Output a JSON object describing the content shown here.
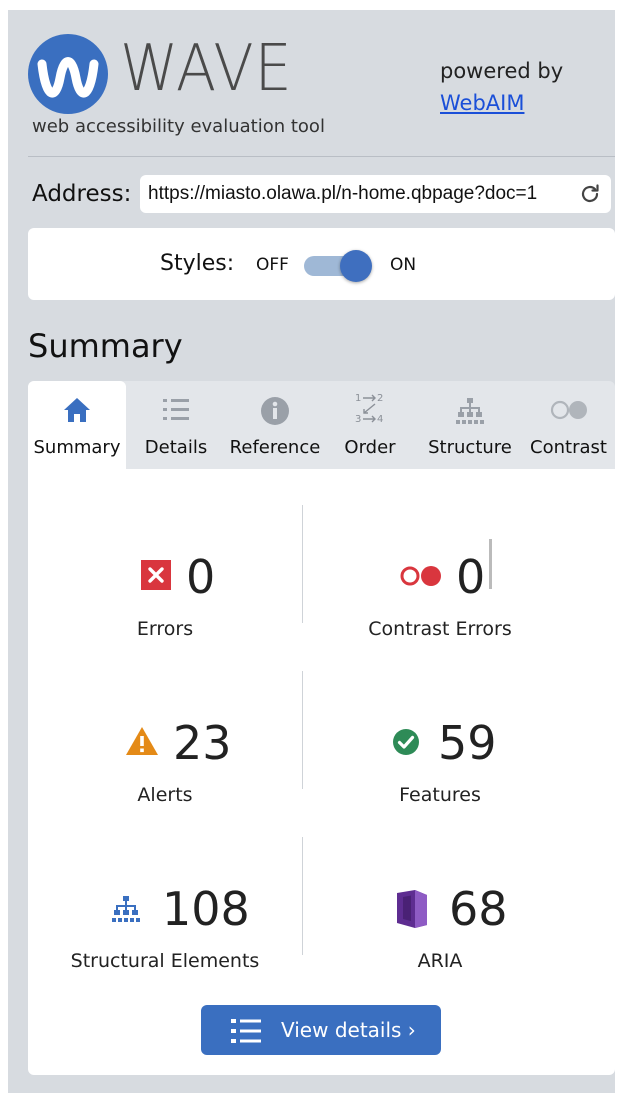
{
  "header": {
    "logo_text": "WAVE",
    "tagline": "web accessibility evaluation tool",
    "powered_by": "powered by",
    "webaim_link": "WebAIM"
  },
  "address": {
    "label": "Address:",
    "value": "https://miasto.olawa.pl/n-home.qbpage?doc=1"
  },
  "styles": {
    "label": "Styles:",
    "off": "OFF",
    "on": "ON",
    "enabled": true
  },
  "section_title": "Summary",
  "tabs": [
    {
      "label": "Summary",
      "icon": "home-icon",
      "active": true
    },
    {
      "label": "Details",
      "icon": "list-icon",
      "active": false
    },
    {
      "label": "Reference",
      "icon": "info-icon",
      "active": false
    },
    {
      "label": "Order",
      "icon": "order-icon",
      "active": false
    },
    {
      "label": "Structure",
      "icon": "structure-icon",
      "active": false
    },
    {
      "label": "Contrast",
      "icon": "contrast-icon",
      "active": false
    }
  ],
  "stats": {
    "errors": {
      "count": "0",
      "label": "Errors",
      "icon": "error-icon"
    },
    "contrast_errors": {
      "count": "0",
      "label": "Contrast Errors",
      "icon": "contrast-error-icon"
    },
    "alerts": {
      "count": "23",
      "label": "Alerts",
      "icon": "alert-icon"
    },
    "features": {
      "count": "59",
      "label": "Features",
      "icon": "feature-check-icon"
    },
    "structural": {
      "count": "108",
      "label": "Structural Elements",
      "icon": "structure-icon"
    },
    "aria": {
      "count": "68",
      "label": "ARIA",
      "icon": "aria-icon"
    }
  },
  "view_details_label": "View details ›",
  "colors": {
    "brand_blue": "#3a6fc0",
    "error_red": "#d9363e",
    "alert_orange": "#e48a17",
    "feature_green": "#2e8b57",
    "aria_purple": "#5e2d91",
    "panel_bg": "#d7dbe0"
  }
}
